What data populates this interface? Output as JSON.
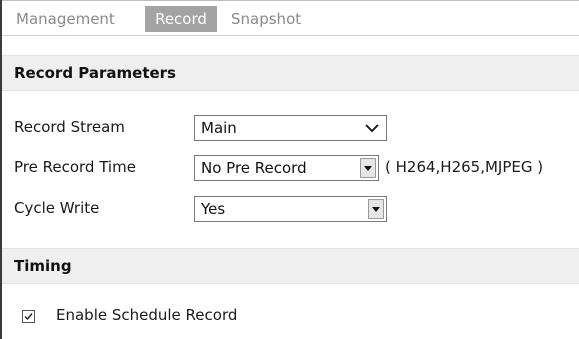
{
  "tabs": [
    {
      "label": "Management",
      "active": false
    },
    {
      "label": "Record",
      "active": true
    },
    {
      "label": "Snapshot",
      "active": false
    }
  ],
  "record_parameters": {
    "title": "Record Parameters",
    "fields": [
      {
        "label": "Record Stream",
        "value": "Main"
      },
      {
        "label": "Pre Record Time",
        "value": "No Pre Record",
        "note": "( H264,H265,MJPEG )"
      },
      {
        "label": "Cycle Write",
        "value": "Yes"
      }
    ]
  },
  "timing": {
    "title": "Timing",
    "schedule_checkbox": {
      "label": "Enable Schedule Record",
      "checked": true
    }
  },
  "icons": {
    "record_stream_dropdown": "chevron-down-icon",
    "pre_record_dropdown": "dropdown-arrow-icon",
    "cycle_write_dropdown": "dropdown-arrow-icon",
    "schedule_check": "checkmark-icon"
  },
  "colors": {
    "active_tab_bg": "#a3a3a3",
    "section_header_bg": "#efefef",
    "inactive_tab_text": "#8a8a8a"
  }
}
